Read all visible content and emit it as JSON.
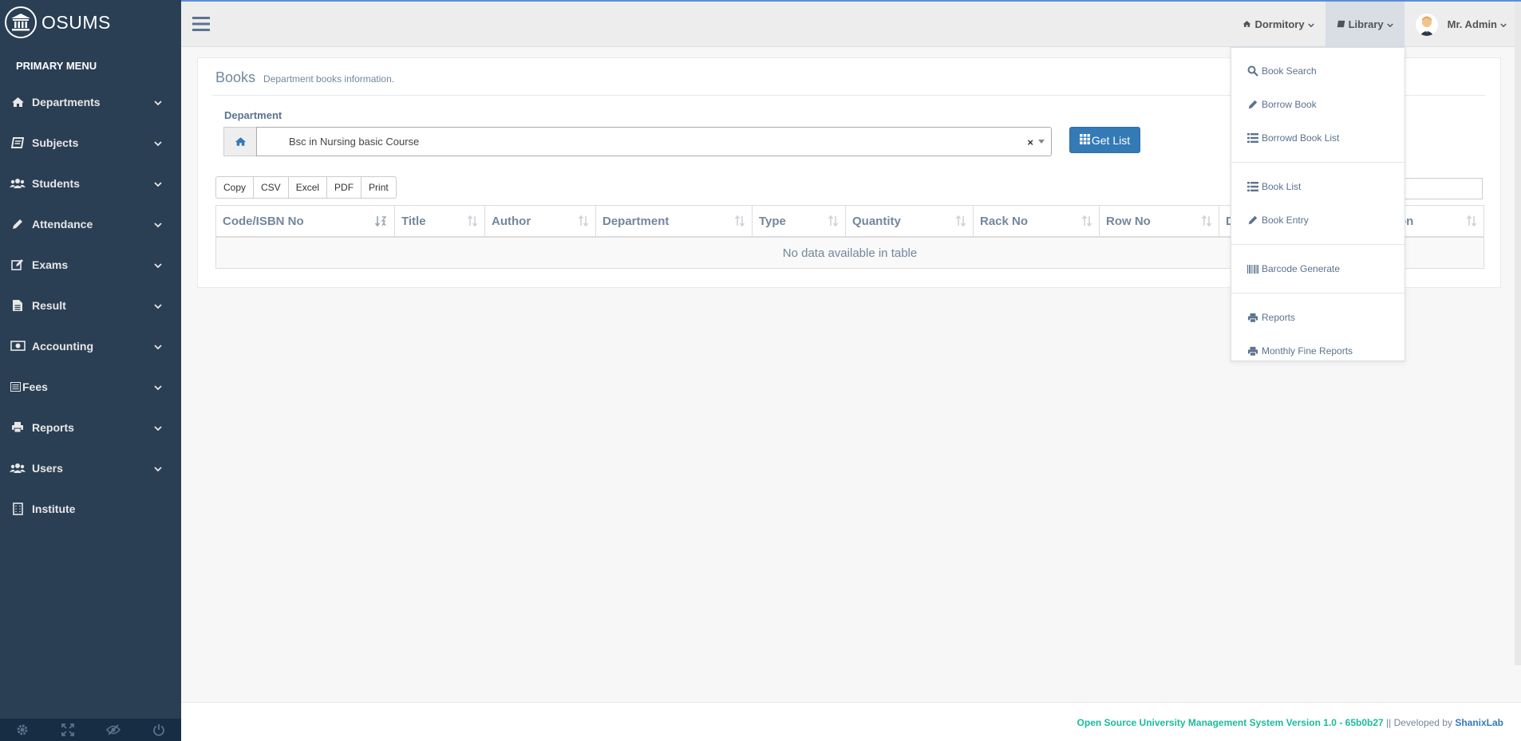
{
  "brand": {
    "name": "OSUMS"
  },
  "sidebar": {
    "section_title": "PRIMARY MENU",
    "items": [
      {
        "label": "Departments",
        "icon": "home-icon",
        "has_children": true
      },
      {
        "label": "Subjects",
        "icon": "book-icon",
        "has_children": true
      },
      {
        "label": "Students",
        "icon": "users-icon",
        "has_children": true
      },
      {
        "label": "Attendance",
        "icon": "pencil-icon",
        "has_children": true
      },
      {
        "label": "Exams",
        "icon": "edit-icon",
        "has_children": true
      },
      {
        "label": "Result",
        "icon": "file-text-icon",
        "has_children": true
      },
      {
        "label": "Accounting",
        "icon": "money-icon",
        "has_children": true
      },
      {
        "label": "Fees",
        "icon": "list-alt-icon",
        "has_children": true
      },
      {
        "label": "Reports",
        "icon": "print-icon",
        "has_children": true
      },
      {
        "label": "Users",
        "icon": "users-icon",
        "has_children": true
      },
      {
        "label": "Institute",
        "icon": "building-icon",
        "has_children": false
      }
    ],
    "footer_icons": [
      "gear-icon",
      "fullscreen-icon",
      "eye-slash-icon",
      "power-icon"
    ]
  },
  "topnav": {
    "dormitory_label": "Dormitory",
    "library_label": "Library",
    "user_label": "Mr. Admin"
  },
  "library_menu": {
    "items": [
      {
        "label": "Book Search",
        "icon": "search-icon"
      },
      {
        "label": "Borrow Book",
        "icon": "pencil-icon"
      },
      {
        "label": "Borrowd Book List",
        "icon": "list-icon"
      },
      {
        "label": "Book List",
        "icon": "list-icon"
      },
      {
        "label": "Book Entry",
        "icon": "pencil-icon"
      },
      {
        "label": "Barcode Generate",
        "icon": "barcode-icon"
      },
      {
        "label": "Reports",
        "icon": "print-icon"
      },
      {
        "label": "Monthly Fine Reports",
        "icon": "print-icon"
      }
    ]
  },
  "page": {
    "title": "Books",
    "subtitle": "Department books information.",
    "department_label": "Department",
    "department_value": "Bsc in Nursing basic Course",
    "get_list_label": "Get List"
  },
  "export_buttons": [
    "Copy",
    "CSV",
    "Excel",
    "PDF",
    "Print"
  ],
  "table": {
    "columns": [
      "Code/ISBN No",
      "Title",
      "Author",
      "Department",
      "Type",
      "Quantity",
      "Rack No",
      "Row No",
      "D",
      "on"
    ],
    "empty_message": "No data available in table"
  },
  "footer": {
    "system_text": "Open Source University Management System Version 1.0 - 65b0b27",
    "separator": " || Developed by ",
    "developer": "ShanixLab"
  },
  "colors": {
    "sidebar_bg": "#2a3f54",
    "primary_button": "#337ab7",
    "footer_accent": "#1abb9c"
  }
}
